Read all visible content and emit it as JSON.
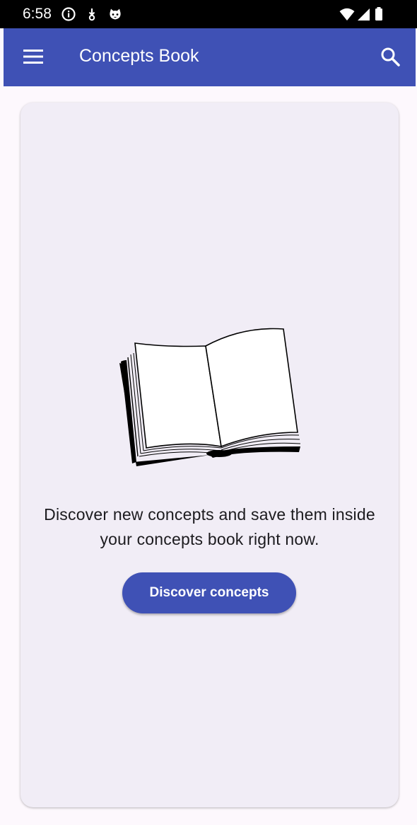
{
  "status_bar": {
    "time": "6:58",
    "left_icons": [
      "info-icon",
      "download-icon",
      "cat-icon"
    ],
    "right_icons": [
      "wifi-icon",
      "signal-icon",
      "battery-icon"
    ]
  },
  "app_bar": {
    "title": "Concepts Book",
    "menu_icon": "hamburger-menu-icon",
    "search_icon": "search-icon",
    "color": "#3f51b5"
  },
  "empty_state": {
    "illustration": "open-book-icon",
    "message": "Discover new concepts and save them inside your concepts book right now.",
    "button_label": "Discover concepts"
  },
  "colors": {
    "accent": "#3f51b5",
    "card_background": "#f1edf6",
    "page_background": "#fdf8fd"
  }
}
